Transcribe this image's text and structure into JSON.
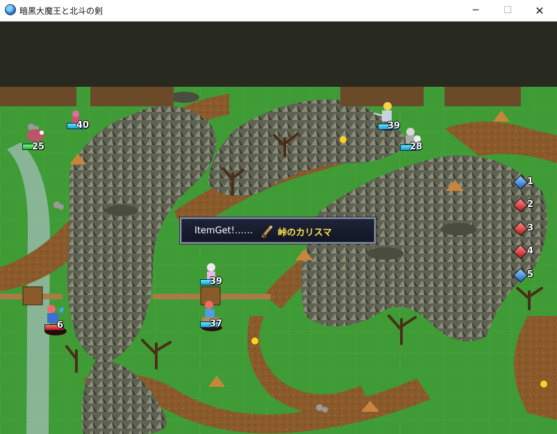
{
  "window": {
    "title": "暗黒大魔王と北斗の剣",
    "minimize_glyph": "─",
    "maximize_glyph": "☐",
    "close_glyph": "✕",
    "icon": "globe-icon"
  },
  "notification": {
    "label": "ItemGet!……",
    "item_icon": "sword-item-icon",
    "item_name": "峠のカリスマ"
  },
  "units": [
    {
      "id": "archer-top-left",
      "hp": "40",
      "bar": "blue"
    },
    {
      "id": "beast-left",
      "hp": "25",
      "bar": "green"
    },
    {
      "id": "knight-top-right",
      "hp": "39",
      "bar": "blue"
    },
    {
      "id": "armor-top-right",
      "hp": "28",
      "bar": "blue"
    },
    {
      "id": "cleric-center",
      "hp": "39",
      "bar": "blue"
    },
    {
      "id": "cavalier-center",
      "hp": "37",
      "bar": "blue"
    },
    {
      "id": "lord-left",
      "hp": "6",
      "bar": "red"
    }
  ],
  "side_list": [
    {
      "num": "1",
      "color": "blue"
    },
    {
      "num": "2",
      "color": "red"
    },
    {
      "num": "3",
      "color": "red"
    },
    {
      "num": "4",
      "color": "red"
    },
    {
      "num": "5",
      "color": "blue"
    }
  ],
  "colors": {
    "grass": "#3f9b35",
    "dirt": "#8a5a2b",
    "mountain": "#6f7061",
    "hud_bar": "#282a1f",
    "highlight_text": "#ffe34d"
  }
}
